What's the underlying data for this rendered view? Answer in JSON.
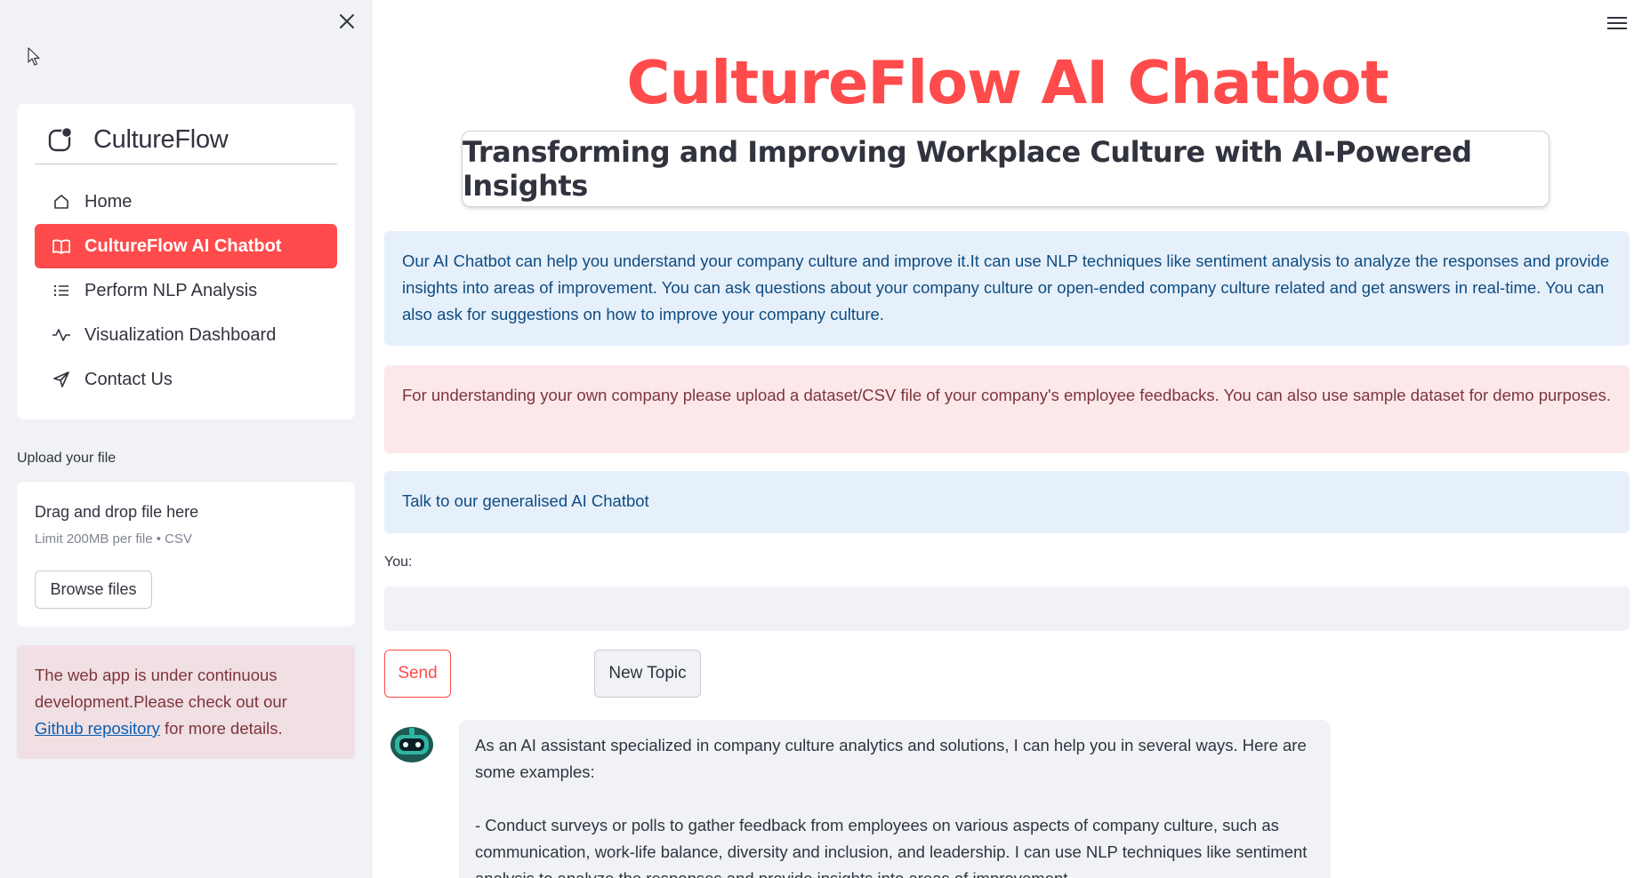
{
  "sidebar": {
    "brand": {
      "title": "CultureFlow",
      "icon": "app-badge-icon"
    },
    "nav_items": [
      {
        "label": "Home",
        "icon": "house-icon",
        "active": false
      },
      {
        "label": "CultureFlow AI Chatbot",
        "icon": "book-icon",
        "active": true
      },
      {
        "label": "Perform NLP Analysis",
        "icon": "list-icon",
        "active": false
      },
      {
        "label": "Visualization Dashboard",
        "icon": "activity-icon",
        "active": false
      },
      {
        "label": "Contact Us",
        "icon": "send-icon",
        "active": false
      }
    ],
    "upload": {
      "label": "Upload your file",
      "title": "Drag and drop file here",
      "limit": "Limit 200MB per file • CSV",
      "browse_label": "Browse files"
    },
    "notice": {
      "text_before": "The web app is under continuous development.Please check out our ",
      "link_text": "Github repository",
      "text_after": " for more details."
    }
  },
  "main": {
    "title": "CultureFlow AI Chatbot",
    "subtitle": "Transforming and Improving Workplace Culture with AI-Powered Insights",
    "info_intro": "Our AI Chatbot can help you understand your company culture and improve it.It can use NLP techniques like sentiment analysis to analyze the responses and provide insights into areas of improvement. You can ask questions about your company culture or open-ended company culture related and get answers in real-time. You can also ask for suggestions on how to improve your company culture.",
    "info_upload": "For understanding your own company please upload a dataset/CSV file of your company's employee feedbacks. You can also use sample dataset for demo purposes.",
    "info_general": "Talk to our generalised AI Chatbot",
    "input_label": "You:",
    "input_value": "",
    "send_label": "Send",
    "new_topic_label": "New Topic",
    "bot_message_p1": "As an AI assistant specialized in company culture analytics and solutions, I can help you in several ways. Here are some examples:",
    "bot_message_p2": "- Conduct surveys or polls to gather feedback from employees on various aspects of company culture, such as communication, work-life balance, diversity and inclusion, and leadership. I can use NLP techniques like sentiment analysis to analyze the responses and provide insights into areas of improvement."
  },
  "colors": {
    "accent": "#ff4b4b",
    "sidebar_bg": "#f0f2f6",
    "info_blue_bg": "#e6f0fb",
    "info_red_bg": "#fce8e9",
    "text": "#31333f"
  }
}
